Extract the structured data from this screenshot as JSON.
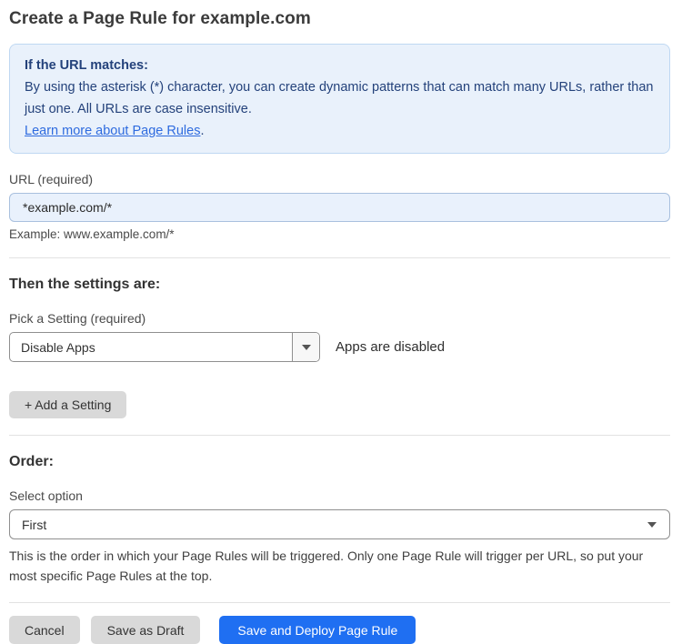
{
  "page": {
    "title": "Create a Page Rule for example.com"
  },
  "info_box": {
    "heading": "If the URL matches:",
    "body": "By using the asterisk (*) character, you can create dynamic patterns that can match many URLs, rather than just one. All URLs are case insensitive.",
    "link_label": "Learn more about Page Rules",
    "link_suffix": "."
  },
  "url_field": {
    "label": "URL (required)",
    "value": "*example.com/*",
    "helper": "Example: www.example.com/*"
  },
  "settings_section": {
    "heading": "Then the settings are:",
    "setting_label": "Pick a Setting (required)",
    "setting_value": "Disable Apps",
    "setting_status": "Apps are disabled",
    "add_setting_label": "+ Add a Setting"
  },
  "order_section": {
    "heading": "Order:",
    "select_label": "Select option",
    "select_value": "First",
    "helper": "This is the order in which your Page Rules will be triggered. Only one Page Rule will trigger per URL, so put your most specific Page Rules at the top."
  },
  "actions": {
    "cancel": "Cancel",
    "save_draft": "Save as Draft",
    "save_deploy": "Save and Deploy Page Rule"
  },
  "colors": {
    "accent_blue": "#1f6ff2",
    "info_bg": "#e9f1fb",
    "info_border": "#bfd8f2",
    "info_text": "#24427b",
    "link_blue": "#2e6bdf",
    "input_bg": "#e9f1fc",
    "input_border": "#a9c0de",
    "button_gray": "#d9d9d9"
  },
  "icons": {
    "dropdown_caret": "caret-down",
    "select_caret": "caret-down"
  }
}
